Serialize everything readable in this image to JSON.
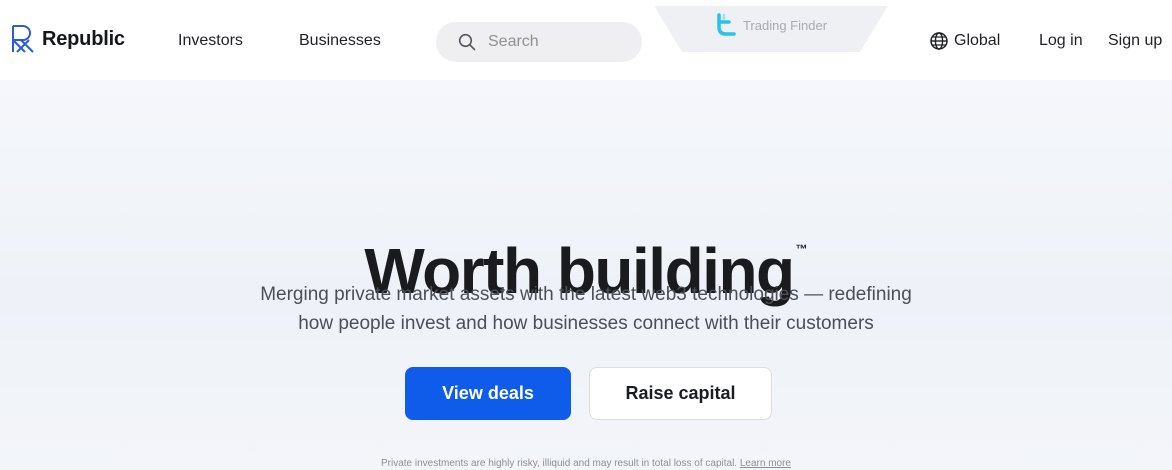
{
  "brand": {
    "name": "Republic",
    "accent": "#0f5bea"
  },
  "nav": {
    "investors": "Investors",
    "businesses": "Businesses",
    "search_placeholder": "Search",
    "global": "Global",
    "login": "Log in",
    "signup": "Sign up"
  },
  "overlay": {
    "label": "Trading Finder"
  },
  "hero": {
    "title": "Worth building",
    "trademark": "™",
    "subtitle_line1": "Merging private market assets with the latest web3 technologies — redefining",
    "subtitle_line2": "how people invest and how businesses connect with their customers",
    "primary_button": "View deals",
    "secondary_button": "Raise capital"
  },
  "footer": {
    "disclaimer": "Private investments are highly risky, illiquid and may result in total loss of capital.",
    "learn_more": "Learn more"
  },
  "icons": {
    "logo": "republic-logo-icon",
    "search": "search-icon",
    "globe": "globe-icon",
    "trading_finder": "trading-finder-logo-icon"
  }
}
